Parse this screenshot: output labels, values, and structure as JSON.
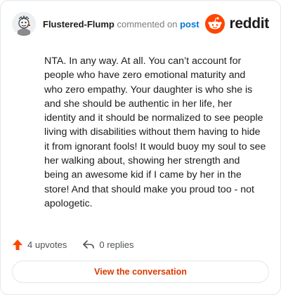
{
  "comment": {
    "author": "Flustered-Flump",
    "action_text": "commented on",
    "link_text": "post",
    "body": "NTA. In any way. At all. You can’t account for people who have zero emotional maturity and who zero empathy. Your daughter is who she is and she should be authentic in her life, her identity and it should be normalized to see people living with disabilities without them having to hide it from ignorant fools! It would buoy my soul to see her walking about, showing her strength and being an awesome kid if I came by her in the store! And that should make you proud too - not apologetic."
  },
  "brand": {
    "wordmark": "reddit",
    "color": "#ff4500"
  },
  "stats": {
    "upvotes": "4 upvotes",
    "replies": "0 replies"
  },
  "cta": {
    "label": "View the conversation",
    "color": "#d93a00"
  },
  "icons": {
    "avatar": "avatar-icon",
    "logo": "reddit-logo-icon",
    "upvote": "upvote-arrow-icon",
    "reply": "reply-arrow-icon"
  }
}
